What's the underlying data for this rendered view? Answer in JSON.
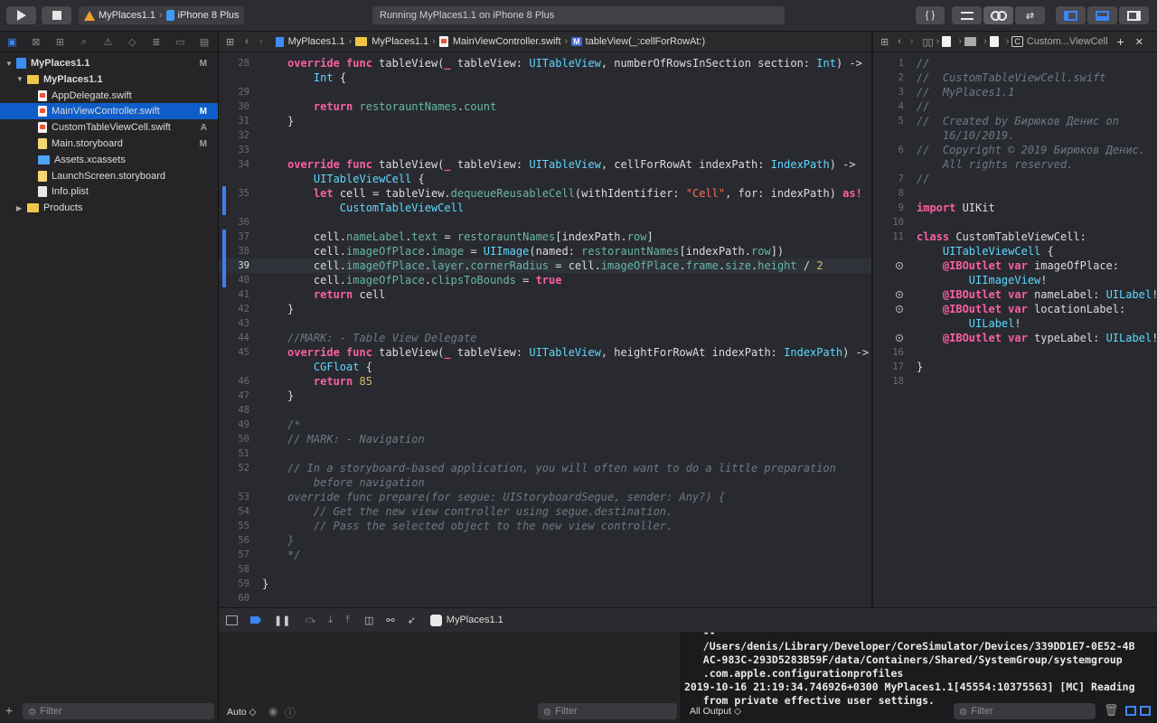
{
  "toolbar": {
    "scheme_project": "MyPlaces1.1",
    "scheme_device": "iPhone 8 Plus",
    "status": "Running MyPlaces1.1 on iPhone 8 Plus",
    "braces_label": "{ }"
  },
  "navigator": {
    "tree": [
      {
        "name": "MyPlaces1.1",
        "type": "project",
        "badge": "M",
        "indent": 0
      },
      {
        "name": "MyPlaces1.1",
        "type": "folder",
        "badge": "",
        "indent": 1
      },
      {
        "name": "AppDelegate.swift",
        "type": "swift",
        "badge": "",
        "indent": 2
      },
      {
        "name": "MainViewController.swift",
        "type": "swift",
        "badge": "M",
        "indent": 2,
        "selected": true
      },
      {
        "name": "CustomTableViewCell.swift",
        "type": "swift",
        "badge": "A",
        "indent": 2
      },
      {
        "name": "Main.storyboard",
        "type": "sb",
        "badge": "M",
        "indent": 2
      },
      {
        "name": "Assets.xcassets",
        "type": "assets",
        "badge": "",
        "indent": 2
      },
      {
        "name": "LaunchScreen.storyboard",
        "type": "sb",
        "badge": "",
        "indent": 2
      },
      {
        "name": "Info.plist",
        "type": "plist",
        "badge": "",
        "indent": 2
      },
      {
        "name": "Products",
        "type": "folder",
        "badge": "",
        "indent": 1
      }
    ],
    "filter_placeholder": "Filter"
  },
  "jumpbar_left": {
    "crumbs": [
      "MyPlaces1.1",
      "MyPlaces1.1",
      "MainViewController.swift",
      "tableView(_:cellForRowAt:)"
    ]
  },
  "jumpbar_right": {
    "file": "Custom...ViewCell"
  },
  "editor_left": {
    "lines": [
      {
        "n": "28",
        "html": "<span class='kw'>override</span> <span class='kw'>func</span> tableView(<span class='kw'>_</span> tableView: <span class='ty'>UITableView</span>, numberOfRowsInSection section: <span class='ty'>Int</span>) ->"
      },
      {
        "n": "",
        "html": "    <span class='ty'>Int</span> {"
      },
      {
        "n": "29",
        "html": ""
      },
      {
        "n": "30",
        "html": "    <span class='kw'>return</span> <span class='fn'>restorauntNames</span>.<span class='fn'>count</span>"
      },
      {
        "n": "31",
        "html": "}"
      },
      {
        "n": "32",
        "html": ""
      },
      {
        "n": "33",
        "html": ""
      },
      {
        "n": "34",
        "html": "<span class='kw'>override</span> <span class='kw'>func</span> tableView(<span class='kw'>_</span> tableView: <span class='ty'>UITableView</span>, cellForRowAt indexPath: <span class='ty'>IndexPath</span>) ->"
      },
      {
        "n": "",
        "html": "    <span class='ty'>UITableViewCell</span> {"
      },
      {
        "n": "35",
        "html": "    <span class='kw'>let</span> cell = tableView.<span class='fn'>dequeueReusableCell</span>(withIdentifier: <span class='str'>\"Cell\"</span>, for: indexPath) <span class='kw'>as!</span>"
      },
      {
        "n": "",
        "html": "        <span class='ty'>CustomTableViewCell</span>"
      },
      {
        "n": "36",
        "html": ""
      },
      {
        "n": "37",
        "html": "    cell.<span class='fn'>nameLabel</span>.<span class='fn'>text</span> = <span class='fn'>restorauntNames</span>[indexPath.<span class='fn'>row</span>]"
      },
      {
        "n": "38",
        "html": "    cell.<span class='fn'>imageOfPlace</span>.<span class='fn'>image</span> = <span class='ty'>UIImage</span>(named: <span class='fn'>restorauntNames</span>[indexPath.<span class='fn'>row</span>])"
      },
      {
        "n": "39",
        "html": "    cell.<span class='fn'>imageOfPlace</span>.<span class='fn'>layer</span>.<span class='fn'>cornerRadius</span> = cell.<span class='fn'>imageOfPlace</span>.<span class='fn'>frame</span>.<span class='fn'>size</span>.<span class='fn'>height</span> / <span class='num'>2</span>",
        "current": true
      },
      {
        "n": "40",
        "html": "    cell.<span class='fn'>imageOfPlace</span>.<span class='fn'>clipsToBounds</span> = <span class='kw'>true</span>"
      },
      {
        "n": "41",
        "html": "    <span class='kw'>return</span> cell"
      },
      {
        "n": "42",
        "html": "}"
      },
      {
        "n": "43",
        "html": ""
      },
      {
        "n": "44",
        "html": "<span class='cm'>//MARK: - Table View Delegate</span>"
      },
      {
        "n": "45",
        "html": "<span class='kw'>override</span> <span class='kw'>func</span> tableView(<span class='kw'>_</span> tableView: <span class='ty'>UITableView</span>, heightForRowAt indexPath: <span class='ty'>IndexPath</span>) ->"
      },
      {
        "n": "",
        "html": "    <span class='ty'>CGFloat</span> {"
      },
      {
        "n": "46",
        "html": "    <span class='kw'>return</span> <span class='num'>85</span>"
      },
      {
        "n": "47",
        "html": "}"
      },
      {
        "n": "48",
        "html": ""
      },
      {
        "n": "49",
        "html": "<span class='cm'>/*</span>"
      },
      {
        "n": "50",
        "html": "<span class='cm'>// MARK: - Navigation</span>"
      },
      {
        "n": "51",
        "html": ""
      },
      {
        "n": "52",
        "html": "<span class='cm'>// In a storyboard-based application, you will often want to do a little preparation</span>"
      },
      {
        "n": "",
        "html": "<span class='cm'>    before navigation</span>"
      },
      {
        "n": "53",
        "html": "<span class='cm'>override func prepare(for segue: UIStoryboardSegue, sender: Any?) {</span>"
      },
      {
        "n": "54",
        "html": "<span class='cm'>    // Get the new view controller using segue.destination.</span>"
      },
      {
        "n": "55",
        "html": "<span class='cm'>    // Pass the selected object to the new view controller.</span>"
      },
      {
        "n": "56",
        "html": "<span class='cm'>}</span>"
      },
      {
        "n": "57",
        "html": "<span class='cm'>*/</span>"
      },
      {
        "n": "58",
        "html": ""
      },
      {
        "n": "59",
        "html": "}",
        "outdent": true
      },
      {
        "n": "60",
        "html": ""
      }
    ]
  },
  "editor_right": {
    "lines": [
      {
        "n": "1",
        "html": "<span class='cm'>//</span>"
      },
      {
        "n": "2",
        "html": "<span class='cm'>//  CustomTableViewCell.swift</span>"
      },
      {
        "n": "3",
        "html": "<span class='cm'>//  MyPlaces1.1</span>"
      },
      {
        "n": "4",
        "html": "<span class='cm'>//</span>"
      },
      {
        "n": "5",
        "html": "<span class='cm'>//  Created by Бирюков Денис on</span>"
      },
      {
        "n": "",
        "html": "<span class='cm'>    16/10/2019.</span>"
      },
      {
        "n": "6",
        "html": "<span class='cm'>//  Copyright © 2019 Бирюков Денис.</span>"
      },
      {
        "n": "",
        "html": "<span class='cm'>    All rights reserved.</span>"
      },
      {
        "n": "7",
        "html": "<span class='cm'>//</span>"
      },
      {
        "n": "8",
        "html": ""
      },
      {
        "n": "9",
        "html": "<span class='kw'>import</span> UIKit"
      },
      {
        "n": "10",
        "html": ""
      },
      {
        "n": "11",
        "html": "<span class='kw'>class</span> CustomTableViewCell:"
      },
      {
        "n": "",
        "html": "    <span class='ty'>UITableViewCell</span> {"
      },
      {
        "n": "",
        "html": "    <span class='kw'>@IBOutlet</span> <span class='kw'>var</span> imageOfPlace:",
        "outlet": true
      },
      {
        "n": "",
        "html": "        <span class='ty'>UIImageView</span>!"
      },
      {
        "n": "",
        "html": "    <span class='kw'>@IBOutlet</span> <span class='kw'>var</span> nameLabel: <span class='ty'>UILabel</span>!",
        "outlet": true
      },
      {
        "n": "",
        "html": "    <span class='kw'>@IBOutlet</span> <span class='kw'>var</span> locationLabel:",
        "outlet": true
      },
      {
        "n": "",
        "html": "        <span class='ty'>UILabel</span>!"
      },
      {
        "n": "",
        "html": "    <span class='kw'>@IBOutlet</span> <span class='kw'>var</span> typeLabel: <span class='ty'>UILabel</span>!",
        "outlet": true
      },
      {
        "n": "16",
        "html": ""
      },
      {
        "n": "17",
        "html": "}"
      },
      {
        "n": "18",
        "html": ""
      }
    ]
  },
  "debugbar": {
    "target": "MyPlaces1.1"
  },
  "variables": {
    "scope": "Auto ◇",
    "filter_placeholder": "Filter"
  },
  "console": {
    "lines": [
      "   --",
      "   /Users/denis/Library/Developer/CoreSimulator/Devices/339DD1E7-0E52-4B",
      "   AC-983C-293D5283B59F/data/Containers/Shared/SystemGroup/systemgroup",
      "   .com.apple.configurationprofiles",
      "2019-10-16 21:19:34.746926+0300 MyPlaces1.1[45554:10375563] [MC] Reading",
      "   from private effective user settings."
    ],
    "output_select": "All Output ◇",
    "filter_placeholder": "Filter"
  }
}
